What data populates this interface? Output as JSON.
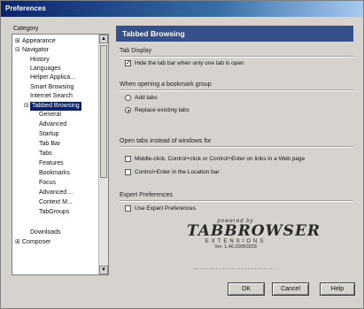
{
  "window": {
    "title": "Preferences"
  },
  "sidebar": {
    "label": "Category",
    "items": [
      {
        "label": "Appearance",
        "toggle": "+"
      },
      {
        "label": "Navigator",
        "toggle": "−"
      },
      {
        "label": "History"
      },
      {
        "label": "Languages"
      },
      {
        "label": "Helper Applica..."
      },
      {
        "label": "Smart Browsing"
      },
      {
        "label": "Internet Search"
      },
      {
        "label": "Tabbed Browsing",
        "toggle": "−"
      },
      {
        "label": "General"
      },
      {
        "label": "Advanced"
      },
      {
        "label": "Startup"
      },
      {
        "label": "Tab Bar"
      },
      {
        "label": "Tabs"
      },
      {
        "label": "Features"
      },
      {
        "label": "Bookmarks"
      },
      {
        "label": "Focus"
      },
      {
        "label": "Advanced ..."
      },
      {
        "label": "Context M..."
      },
      {
        "label": "TabGroups"
      },
      {
        "label": "Downloads"
      },
      {
        "label": "Composer",
        "toggle": "+"
      }
    ],
    "selected": "Tabbed Browsing"
  },
  "panel": {
    "title": "Tabbed Browsing",
    "tab_display": {
      "title": "Tab Display",
      "hide_tab_bar": {
        "label": "Hide the tab bar when only one tab is open",
        "checked": true
      }
    },
    "bookmark_group": {
      "title": "When opening a bookmark group",
      "add_tabs": {
        "label": "Add tabs",
        "selected": false
      },
      "replace_tabs": {
        "label": "Replace existing tabs",
        "selected": true
      }
    },
    "open_tabs": {
      "title": "Open tabs instead of windows for",
      "middle_click": {
        "label": "Middle-click, Control+click or Control+Enter on links in a Web page",
        "checked": false
      },
      "location_bar": {
        "label": "Control+Enter in the Location bar",
        "checked": false
      }
    },
    "expert": {
      "title": "Expert Preferences",
      "use_expert": {
        "label": "Use Expert Preferences",
        "checked": false
      }
    },
    "logo": {
      "powered": "powered by",
      "name": "TABBROWSER",
      "extensions": "EXTENSIONS",
      "version": "Ver. 1.40.20050203"
    }
  },
  "buttons": {
    "ok": "OK",
    "cancel": "Cancel",
    "help": "Help"
  },
  "colors": {
    "selection": "#0a246a",
    "header": "#36508c",
    "dialog_bg": "#d6d3ce"
  }
}
